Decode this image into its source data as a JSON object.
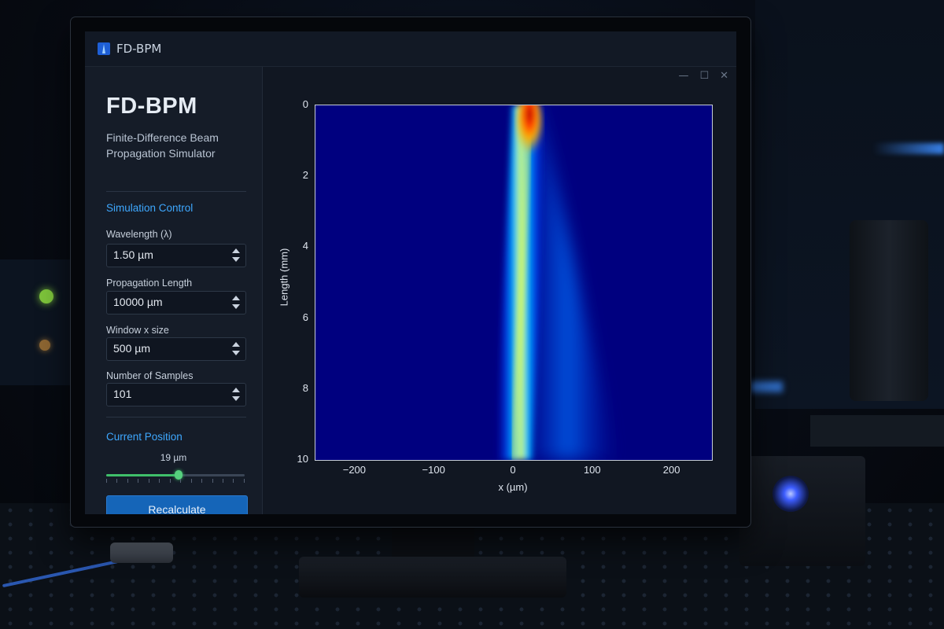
{
  "window": {
    "title": "FD-BPM"
  },
  "sidebar": {
    "brand": "FD-BPM",
    "subtitle": "Finite-Difference Beam Propagation Simulator",
    "section_control": "Simulation Control",
    "fields": [
      {
        "label": "Wavelength (λ)",
        "value": "1.50 µm"
      },
      {
        "label": "Propagation Length",
        "value": "10000 µm"
      },
      {
        "label": "Window x size",
        "value": "500 µm"
      },
      {
        "label": "Number of Samples",
        "value": "101"
      }
    ],
    "section_position": "Current Position",
    "position": {
      "value_text": "19 µm",
      "fraction": 0.52
    },
    "recalc_label": "Recalculate"
  },
  "window_controls": [
    "—",
    "☐",
    "✕"
  ],
  "chart_data": {
    "type": "heatmap",
    "title": "",
    "xlabel": "x (µm)",
    "ylabel": "Length (mm)",
    "xlim": [
      -250,
      250
    ],
    "ylim": [
      0,
      10
    ],
    "x_ticks": [
      "−200",
      "−100",
      "0",
      "100",
      "200"
    ],
    "y_ticks": [
      "0",
      "2",
      "4",
      "6",
      "8",
      "10"
    ],
    "colormap": "jet",
    "beam": {
      "start_center_um": 20,
      "main_branch_end_um": 0,
      "secondary_branch_end_um": 70,
      "peak_at_length_mm": 0.4
    }
  },
  "colors": {
    "accent": "#3ea8ff",
    "button": "#1565b8",
    "slider": "#3fbf6a"
  }
}
